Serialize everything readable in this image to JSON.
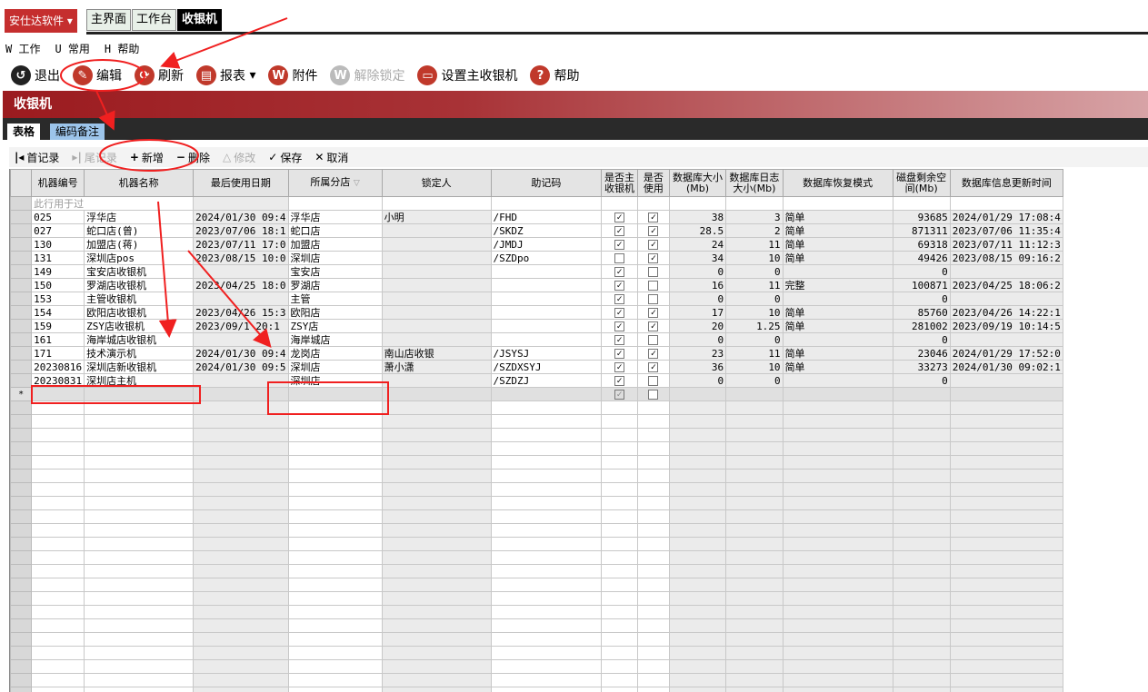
{
  "brand": {
    "label": "安仕达软件"
  },
  "nav_tabs": [
    {
      "label": "主界面"
    },
    {
      "label": "工作台"
    },
    {
      "label": "收银机"
    }
  ],
  "menu": [
    {
      "label": "W 工作"
    },
    {
      "label": "U 常用"
    },
    {
      "label": "H 帮助"
    }
  ],
  "toolbar": [
    {
      "label": "退出",
      "icon": "exit-icon"
    },
    {
      "label": "编辑",
      "icon": "edit-icon"
    },
    {
      "label": "刷新",
      "icon": "refresh-icon"
    },
    {
      "label": "报表",
      "icon": "print-icon"
    },
    {
      "label": "附件",
      "icon": "attachment-icon"
    },
    {
      "label": "解除锁定",
      "icon": "unlock-icon",
      "disabled": true
    },
    {
      "label": "设置主收银机",
      "icon": "monitor-icon"
    },
    {
      "label": "帮助",
      "icon": "help-icon"
    }
  ],
  "page_title": "收银机",
  "sub_tabs": [
    {
      "label": "表格"
    },
    {
      "label": "编码备注"
    }
  ],
  "grid_toolbar": {
    "first": "首记录",
    "last": "尾记录",
    "add": "新增",
    "delete": "删除",
    "modify": "修改",
    "save": "保存",
    "cancel": "取消"
  },
  "columns": [
    "机器编号",
    "机器名称",
    "最后使用日期",
    "所属分店",
    "锁定人",
    "助记码",
    "是否主收银机",
    "是否使用",
    "数据库大小(Mb)",
    "数据库日志大小(Mb)",
    "数据库恢复模式",
    "磁盘剩余空间(Mb)",
    "数据库信息更新时间"
  ],
  "filter_row_text": "此行用于过",
  "rows": [
    {
      "id": "025",
      "name": "浮华店",
      "date": "2024/01/30 09:4",
      "branch": "浮华店",
      "lock": "小明",
      "code": "/FHD",
      "main": true,
      "use": true,
      "dbsize": "38",
      "logsize": "3",
      "mode": "简单",
      "disk": "93685",
      "updated": "2024/01/29 17:08:4"
    },
    {
      "id": "027",
      "name": "蛇口店(曾)",
      "date": "2023/07/06 18:1",
      "branch": "蛇口店",
      "lock": "",
      "code": "/SKDZ",
      "main": true,
      "use": true,
      "dbsize": "28.5",
      "logsize": "2",
      "mode": "简单",
      "disk": "871311",
      "updated": "2023/07/06 11:35:4"
    },
    {
      "id": "130",
      "name": "加盟店(蒋)",
      "date": "2023/07/11 17:0",
      "branch": "加盟店",
      "lock": "",
      "code": "/JMDJ",
      "main": true,
      "use": true,
      "dbsize": "24",
      "logsize": "11",
      "mode": "简单",
      "disk": "69318",
      "updated": "2023/07/11 11:12:3"
    },
    {
      "id": "131",
      "name": "深圳店pos",
      "date": "2023/08/15 10:0",
      "branch": "深圳店",
      "lock": "",
      "code": "/SZDpo",
      "main": false,
      "use": true,
      "dbsize": "34",
      "logsize": "10",
      "mode": "简单",
      "disk": "49426",
      "updated": "2023/08/15 09:16:2"
    },
    {
      "id": "149",
      "name": "宝安店收银机",
      "date": "",
      "branch": "宝安店",
      "lock": "",
      "code": "",
      "main": true,
      "use": false,
      "dbsize": "0",
      "logsize": "0",
      "mode": "",
      "disk": "0",
      "updated": ""
    },
    {
      "id": "150",
      "name": "罗湖店收银机",
      "date": "2023/04/25 18:0",
      "branch": "罗湖店",
      "lock": "",
      "code": "",
      "main": true,
      "use": false,
      "dbsize": "16",
      "logsize": "11",
      "mode": "完整",
      "disk": "100871",
      "updated": "2023/04/25 18:06:2"
    },
    {
      "id": "153",
      "name": "主管收银机",
      "date": "",
      "branch": "主管",
      "lock": "",
      "code": "",
      "main": true,
      "use": false,
      "dbsize": "0",
      "logsize": "0",
      "mode": "",
      "disk": "0",
      "updated": ""
    },
    {
      "id": "154",
      "name": "欧阳店收银机",
      "date": "2023/04/26 15:3",
      "branch": "欧阳店",
      "lock": "",
      "code": "",
      "main": true,
      "use": true,
      "dbsize": "17",
      "logsize": "10",
      "mode": "简单",
      "disk": "85760",
      "updated": "2023/04/26 14:22:1"
    },
    {
      "id": "159",
      "name": "ZSY店收银机",
      "date": "2023/09/1  20:1",
      "branch": "ZSY店",
      "lock": "",
      "code": "",
      "main": true,
      "use": true,
      "dbsize": "20",
      "logsize": "1.25",
      "mode": "简单",
      "disk": "281002",
      "updated": "2023/09/19 10:14:5"
    },
    {
      "id": "161",
      "name": "海岸城店收银机",
      "date": "",
      "branch": "海岸城店",
      "lock": "",
      "code": "",
      "main": true,
      "use": false,
      "dbsize": "0",
      "logsize": "0",
      "mode": "",
      "disk": "0",
      "updated": ""
    },
    {
      "id": "171",
      "name": "技术演示机",
      "date": "2024/01/30 09:4",
      "branch": "龙岗店",
      "lock": "南山店收银",
      "code": "/JSYSJ",
      "main": true,
      "use": true,
      "dbsize": "23",
      "logsize": "11",
      "mode": "简单",
      "disk": "23046",
      "updated": "2024/01/29 17:52:0"
    },
    {
      "id": "20230816",
      "name": "深圳店新收银机",
      "date": "2024/01/30 09:5",
      "branch": "深圳店",
      "lock": "萧小潇",
      "code": "/SZDXSYJ",
      "main": true,
      "use": true,
      "dbsize": "36",
      "logsize": "10",
      "mode": "简单",
      "disk": "33273",
      "updated": "2024/01/30 09:02:1"
    },
    {
      "id": "20230831",
      "name": "深圳店主机",
      "date": "",
      "branch": "深圳店",
      "lock": "",
      "code": "/SZDZJ",
      "main": true,
      "use": false,
      "dbsize": "0",
      "logsize": "0",
      "mode": "",
      "disk": "0",
      "updated": ""
    }
  ],
  "new_row_marker": "*"
}
